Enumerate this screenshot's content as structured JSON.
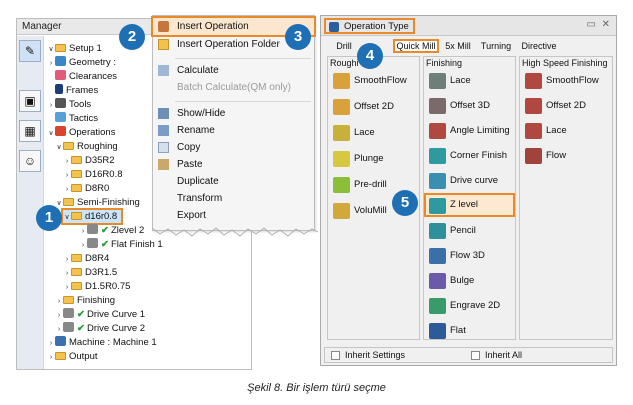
{
  "manager": {
    "title": "Manager",
    "tree": [
      {
        "label": "Setup 1"
      },
      {
        "label": "Geometry :"
      },
      {
        "label": "Clearances"
      },
      {
        "label": "Frames"
      },
      {
        "label": "Tools"
      },
      {
        "label": "Tactics"
      },
      {
        "label": "Operations"
      },
      {
        "label": "Roughing"
      },
      {
        "label": "D35R2"
      },
      {
        "label": "D16R0.8"
      },
      {
        "label": "D8R0"
      },
      {
        "label": "Semi-Finishing"
      },
      {
        "label": "d16r0.8"
      },
      {
        "label": "Zlevel 2"
      },
      {
        "label": "Flat Finish 1"
      },
      {
        "label": "D8R4"
      },
      {
        "label": "D3R1.5"
      },
      {
        "label": "D1.5R0.75"
      },
      {
        "label": "Finishing"
      },
      {
        "label": "Drive Curve 1"
      },
      {
        "label": "Drive Curve 2"
      },
      {
        "label": "Machine : Machine 1"
      },
      {
        "label": "Output"
      }
    ]
  },
  "context_menu": {
    "items": [
      {
        "label": "Insert Operation"
      },
      {
        "label": "Insert Operation Folder"
      },
      {
        "label": "Calculate"
      },
      {
        "label": "Batch Calculate(QM only)"
      },
      {
        "label": "Show/Hide"
      },
      {
        "label": "Rename"
      },
      {
        "label": "Copy"
      },
      {
        "label": "Paste"
      },
      {
        "label": "Duplicate"
      },
      {
        "label": "Transform"
      },
      {
        "label": "Export"
      }
    ]
  },
  "operation_type": {
    "title": "Operation Type",
    "tabs": [
      "Drill",
      "Quick Mill",
      "5x Mill",
      "Turning",
      "Directive"
    ],
    "groups": {
      "roughing": {
        "label": "Roughi",
        "items": [
          "SmoothFlow",
          "Offset 2D",
          "Lace",
          "Plunge",
          "Pre-drill",
          "VoluMill"
        ]
      },
      "finishing": {
        "label": "Finishing",
        "items": [
          "Lace",
          "Offset 3D",
          "Angle Limiting",
          "Corner Finish",
          "Drive curve",
          "Z level",
          "Pencil",
          "Flow 3D",
          "Bulge",
          "Engrave 2D",
          "Flat"
        ]
      },
      "hsf": {
        "label": "High Speed Finishing",
        "items": [
          "SmoothFlow",
          "Offset 2D",
          "Lace",
          "Flow"
        ]
      }
    },
    "bottom": {
      "inherit_settings": "Inherit Settings",
      "inherit_all": "Inherit All"
    }
  },
  "badges": [
    "1",
    "2",
    "3",
    "4",
    "5"
  ],
  "caption": "Şekil 8. Bir işlem türü seçme",
  "colors": {
    "highlight": "#e88a2a",
    "badge": "#1f6fb4",
    "folder": "#f2c14e",
    "check": "#1e9e34"
  }
}
